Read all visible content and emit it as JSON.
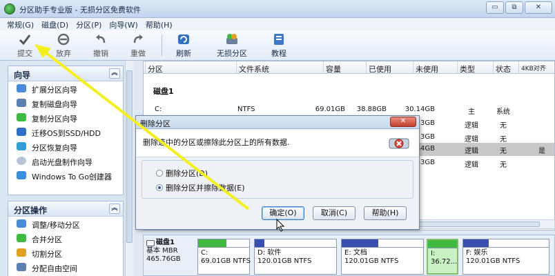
{
  "window": {
    "title": "分区助手专业版 - 无损分区免费软件",
    "buttons": [
      "▭",
      "⧉",
      "✕"
    ]
  },
  "menu": [
    "常规(G)",
    "磁盘(D)",
    "分区(P)",
    "向导(W)",
    "帮助(H)"
  ],
  "toolbar": [
    {
      "label": "提交",
      "icon": "checkmark-icon"
    },
    {
      "label": "放弃",
      "icon": "discard-icon"
    },
    {
      "label": "撤销",
      "icon": "undo-icon"
    },
    {
      "label": "重做",
      "icon": "redo-icon"
    },
    {
      "label": "刷新",
      "icon": "refresh-icon"
    },
    {
      "label": "无损分区",
      "icon": "partition-icon"
    },
    {
      "label": "教程",
      "icon": "tutorial-icon"
    }
  ],
  "wizard_panel": {
    "title": "向导",
    "items": [
      "扩展分区向导",
      "复制磁盘向导",
      "复制分区向导",
      "迁移OS到SSD/HDD",
      "分区恢复向导",
      "启动光盘制作向导",
      "Windows To Go创建器"
    ]
  },
  "ops_panel": {
    "title": "分区操作",
    "items": [
      "调整/移动分区",
      "合并分区",
      "切割分区",
      "分配自由空间"
    ]
  },
  "table": {
    "headers": [
      "分区",
      "文件系统",
      "容量",
      "已使用",
      "未使用",
      "类型",
      "状态",
      "4KB对齐"
    ],
    "disk_title": "磁盘1",
    "rows": [
      {
        "part": "C:",
        "fs": "NTFS",
        "cap": "69.01GB",
        "used": "38.88GB",
        "free": "30.14GB",
        "type": "主",
        "status": "系统",
        "align": ""
      },
      {
        "part": "",
        "fs": "",
        "cap": "",
        "used": "",
        "free": "3GB",
        "type": "逻辑",
        "status": "无",
        "align": ""
      },
      {
        "part": "",
        "fs": "",
        "cap": "",
        "used": "",
        "free": "3GB",
        "type": "逻辑",
        "status": "无",
        "align": ""
      },
      {
        "part": "",
        "fs": "",
        "cap": "",
        "used": "",
        "free": "64GB",
        "type": "逻辑",
        "status": "无",
        "align": "是"
      },
      {
        "part": "",
        "fs": "",
        "cap": "",
        "used": "",
        "free": "43GB",
        "type": "逻辑",
        "status": "无",
        "align": ""
      }
    ]
  },
  "diskmap": {
    "name": "磁盘1",
    "type": "基本 MBR",
    "size": "465.76GB",
    "partitions": [
      {
        "name": "C:",
        "info": "69.01GB NTFS",
        "used_fraction": 0.56,
        "color": "#3fb93f"
      },
      {
        "name": "D: 软件",
        "info": "120.01GB NTFS",
        "used_fraction": 0.12,
        "color": "#3b4fb0"
      },
      {
        "name": "E: 文档",
        "info": "120.01GB NTFS",
        "used_fraction": 0.45,
        "color": "#3b4fb0"
      },
      {
        "name": "I:",
        "info": "36.72...",
        "used_fraction": 1.0,
        "color": "#3fb93f"
      },
      {
        "name": "F: 娱乐",
        "info": "120.01GB NTFS",
        "used_fraction": 0.3,
        "color": "#3b4fb0"
      }
    ]
  },
  "dialog": {
    "title": "删除分区",
    "close": "✕",
    "message": "删除选中的分区或擦除此分区上的所有数据.",
    "option1": "删除分区(D)",
    "option2": "删除分区并擦除数据(E)",
    "ok": "确定(O)",
    "cancel": "取消(C)",
    "help": "帮助(H)"
  }
}
